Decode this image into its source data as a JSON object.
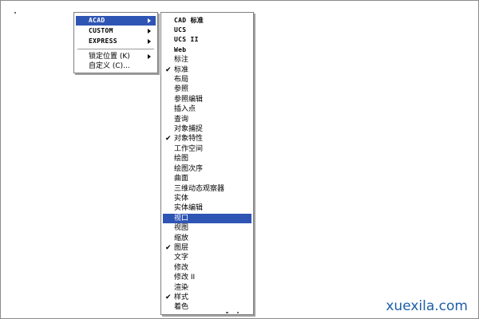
{
  "context_menu": {
    "items": [
      {
        "label": "ACAD",
        "submenu": true,
        "highlighted": true
      },
      {
        "label": "CUSTOM",
        "submenu": true
      },
      {
        "label": "EXPRESS",
        "submenu": true
      },
      {
        "label": "锁定位置 (K)",
        "submenu": true
      },
      {
        "label": "自定义 (C)..."
      }
    ]
  },
  "toolbars_submenu": {
    "items": [
      {
        "label": "CAD 标准",
        "checked": false
      },
      {
        "label": "UCS",
        "checked": false
      },
      {
        "label": "UCS II",
        "checked": false
      },
      {
        "label": "Web",
        "checked": false
      },
      {
        "label": "标注",
        "checked": false
      },
      {
        "label": "标准",
        "checked": true
      },
      {
        "label": "布局",
        "checked": false
      },
      {
        "label": "参照",
        "checked": false
      },
      {
        "label": "参照编辑",
        "checked": false
      },
      {
        "label": "插入点",
        "checked": false
      },
      {
        "label": "查询",
        "checked": false
      },
      {
        "label": "对象捕捉",
        "checked": false
      },
      {
        "label": "对象特性",
        "checked": true
      },
      {
        "label": "工作空间",
        "checked": false
      },
      {
        "label": "绘图",
        "checked": false
      },
      {
        "label": "绘图次序",
        "checked": false
      },
      {
        "label": "曲面",
        "checked": false
      },
      {
        "label": "三维动态观察器",
        "checked": false
      },
      {
        "label": "实体",
        "checked": false
      },
      {
        "label": "实体编辑",
        "checked": false
      },
      {
        "label": "视口",
        "checked": false,
        "highlighted": true
      },
      {
        "label": "视图",
        "checked": false
      },
      {
        "label": "缩放",
        "checked": false
      },
      {
        "label": "图层",
        "checked": true
      },
      {
        "label": "文字",
        "checked": false
      },
      {
        "label": "修改",
        "checked": false
      },
      {
        "label": "修改 II",
        "checked": false
      },
      {
        "label": "渲染",
        "checked": false
      },
      {
        "label": "样式",
        "checked": true
      },
      {
        "label": "着色",
        "checked": false
      }
    ]
  },
  "checkmark_glyph": "✔",
  "watermark": "xuexila.com",
  "colors": {
    "highlight": "#2f55b4",
    "watermark": "#1d5fa8"
  }
}
